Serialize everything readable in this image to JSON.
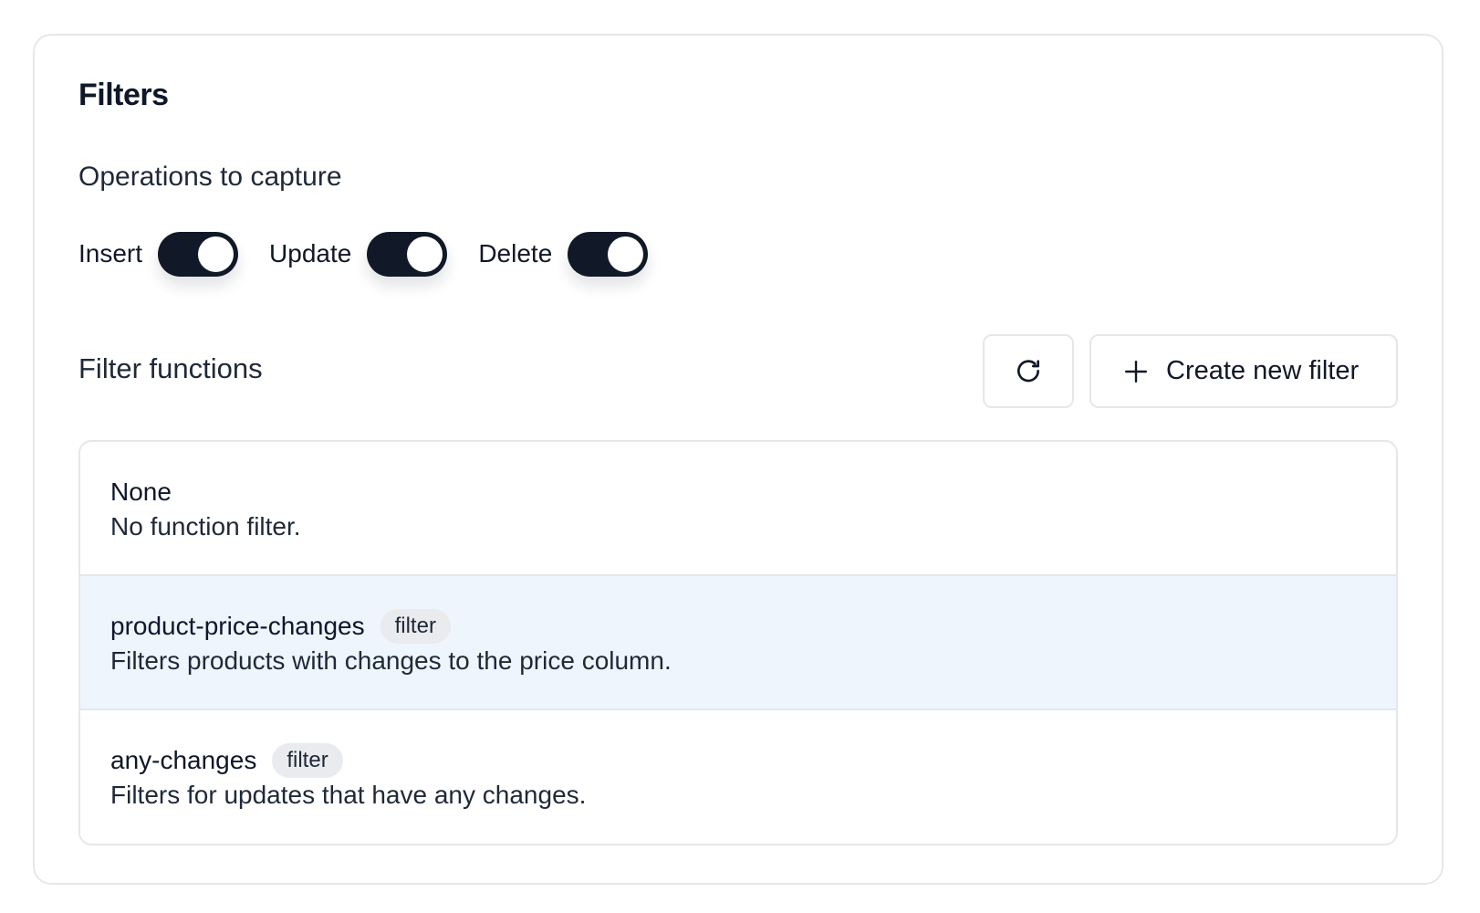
{
  "panel": {
    "title": "Filters"
  },
  "operations": {
    "label": "Operations to capture",
    "toggles": [
      {
        "label": "Insert",
        "on": true
      },
      {
        "label": "Update",
        "on": true
      },
      {
        "label": "Delete",
        "on": true
      }
    ]
  },
  "filter_functions": {
    "title": "Filter functions",
    "refresh_icon": "refresh-icon",
    "create_icon": "plus-icon",
    "create_label": "Create new filter",
    "items": [
      {
        "name": "None",
        "description": "No function filter.",
        "badge": "",
        "selected": false
      },
      {
        "name": "product-price-changes",
        "description": "Filters products with changes to the price column.",
        "badge": "filter",
        "selected": true
      },
      {
        "name": "any-changes",
        "description": "Filters for updates that have any changes.",
        "badge": "filter",
        "selected": false
      }
    ]
  },
  "colors": {
    "toggle_on": "#111827",
    "selected_row": "#eef5fd",
    "border": "#e5e7eb",
    "badge_bg": "#e9ebee"
  }
}
